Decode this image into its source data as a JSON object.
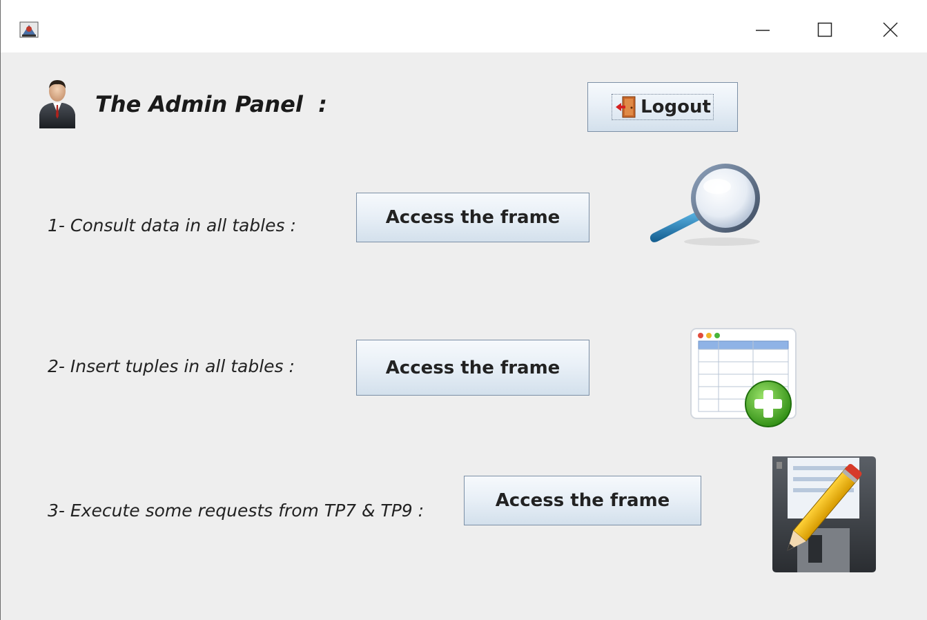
{
  "window": {
    "icon": "java-app-icon",
    "controls": [
      "minimize-icon",
      "maximize-icon",
      "close-icon"
    ]
  },
  "header": {
    "icon": "admin-user-icon",
    "title": "The Admin Panel  :"
  },
  "logout": {
    "icon": "exit-door-icon",
    "label": "Logout"
  },
  "rows": [
    {
      "label": "1- Consult data in all tables :",
      "button": "Access the frame",
      "icon": "magnifier-icon"
    },
    {
      "label": "2- Insert tuples in all tables :",
      "button": "Access the frame",
      "icon": "table-add-icon"
    },
    {
      "label": "3- Execute some requests from TP7 & TP9 :",
      "button": "Access the frame",
      "icon": "floppy-edit-icon"
    }
  ],
  "colors": {
    "window_bg": "#eeeeee",
    "button_border": "#7a8ea5",
    "button_gradient_top": "#f6f9fc",
    "button_gradient_bottom": "#d3e0ec"
  }
}
